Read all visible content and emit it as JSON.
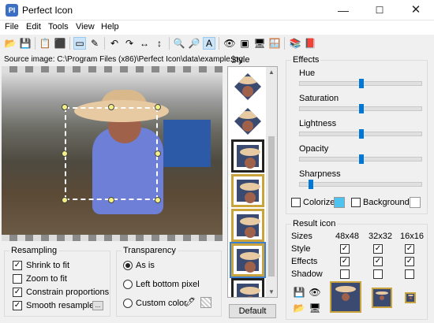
{
  "window": {
    "title": "Perfect Icon",
    "app_icon": "PI",
    "minimize": "—",
    "maximize": "☐",
    "close": "✕"
  },
  "menu": [
    "File",
    "Edit",
    "Tools",
    "View",
    "Help"
  ],
  "toolbar_icons": [
    "📂",
    "💾",
    "📋",
    "⬛",
    "▭",
    "✎",
    "↶",
    "↷",
    "↔",
    "↕",
    "🔍",
    "🔎",
    "A",
    "👁",
    "▣",
    "🖥",
    "🪟",
    "📚",
    "📕"
  ],
  "source_image": "Source image: C:\\Program Files (x86)\\Perfect Icon\\data\\example.jpg",
  "style": {
    "label": "Style",
    "up_arrow": "▲",
    "down_arrow": "▼",
    "default_button": "Default"
  },
  "effects": {
    "title": "Effects",
    "sliders": [
      {
        "label": "Hue",
        "value": 0.5
      },
      {
        "label": "Saturation",
        "value": 0.5
      },
      {
        "label": "Lightness",
        "value": 0.5
      },
      {
        "label": "Opacity",
        "value": 0.5
      },
      {
        "label": "Sharpness",
        "value": 0.07
      }
    ],
    "colorize_label": "Colorize",
    "colorize_color": "#4ec3ef",
    "background_label": "Background",
    "background_color": "#ffffff"
  },
  "result_icon": {
    "title": "Result icon",
    "row_labels": [
      "Sizes",
      "Style",
      "Effects",
      "Shadow"
    ],
    "sizes": [
      "48x48",
      "32x32",
      "16x16"
    ],
    "style_checks": [
      true,
      true,
      true
    ],
    "effects_checks": [
      true,
      true,
      true
    ],
    "shadow_checks": [
      false,
      false,
      false
    ],
    "check_mark": "✓"
  },
  "resampling": {
    "title": "Resampling",
    "options": [
      {
        "label": "Shrink to fit",
        "checked": true
      },
      {
        "label": "Zoom to fit",
        "checked": false
      },
      {
        "label": "Constrain proportions",
        "checked": true
      },
      {
        "label": "Smooth resample",
        "checked": true
      }
    ],
    "more_button": "..."
  },
  "transparency": {
    "title": "Transparency",
    "options": [
      {
        "label": "As is",
        "selected": true
      },
      {
        "label": "Left bottom pixel",
        "selected": false
      },
      {
        "label": "Custom color",
        "selected": false
      }
    ],
    "picker_icon": "🖊"
  }
}
